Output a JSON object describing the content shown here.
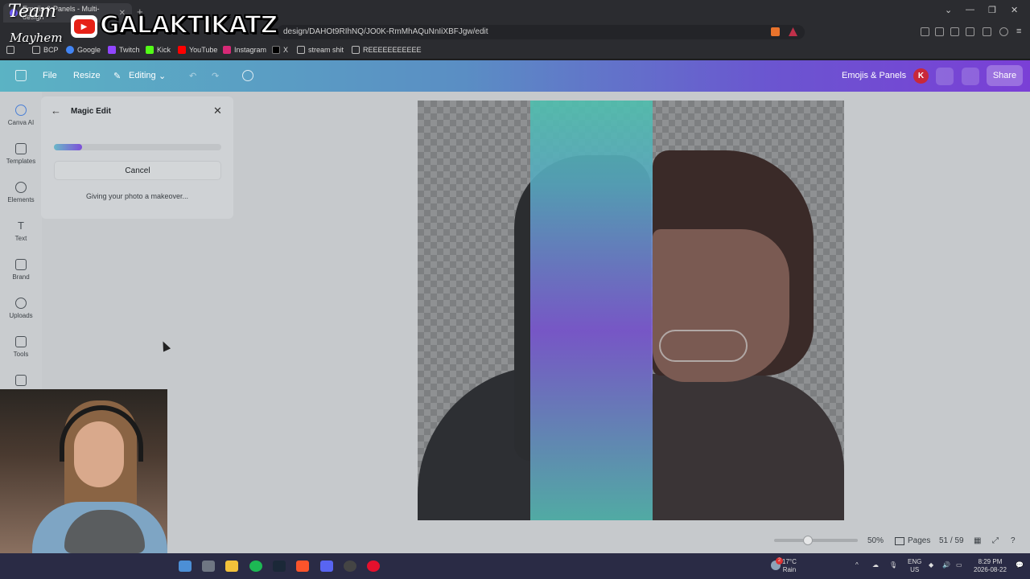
{
  "browser": {
    "tab_title": "Emojis & Panels - Multi-design",
    "url": "design/DAHOt9RIhNQ/JO0K-RmMhAQuNnIiXBFJgw/edit",
    "bookmarks": [
      "BCP",
      "Google",
      "Twitch",
      "Kick",
      "YouTube",
      "Instagram",
      "X",
      "stream shit",
      "REEEEEEEEEEE"
    ]
  },
  "header": {
    "file_label": "File",
    "resize_label": "Resize",
    "editing_label": "Editing",
    "design_title": "Emojis & Panels",
    "avatar_initial": "K",
    "share_label": "Share"
  },
  "rail": {
    "items": [
      {
        "label": "Canva AI",
        "icon": "canva-ai-icon"
      },
      {
        "label": "Templates",
        "icon": "templates-icon"
      },
      {
        "label": "Elements",
        "icon": "elements-icon"
      },
      {
        "label": "Text",
        "icon": "text-icon"
      },
      {
        "label": "Brand",
        "icon": "brand-icon"
      },
      {
        "label": "Uploads",
        "icon": "uploads-icon"
      },
      {
        "label": "Tools",
        "icon": "tools-icon"
      },
      {
        "label": "",
        "icon": "projects-icon"
      }
    ]
  },
  "panel": {
    "title": "Magic Edit",
    "progress": 0.17,
    "cancel_label": "Cancel",
    "status": "Giving your photo a makeover..."
  },
  "footer": {
    "zoom": "50%",
    "zoom_level": 0.5,
    "pages_label": "Pages",
    "page_counter": "51 / 59"
  },
  "taskbar": {
    "weather_temp": "17°C",
    "weather_desc": "Rain",
    "lang": "ENG",
    "region": "US",
    "time": "8:29 PM",
    "date": "2026-08-22",
    "notif_count": "2"
  },
  "overlay": {
    "team": "Team",
    "mayhem": "Mayhem",
    "channel": "GALAKTIKATZ"
  },
  "colors": {
    "header_start": "#5bb3c4",
    "header_end": "#7a3fd6",
    "avatar": "#c9283a"
  }
}
